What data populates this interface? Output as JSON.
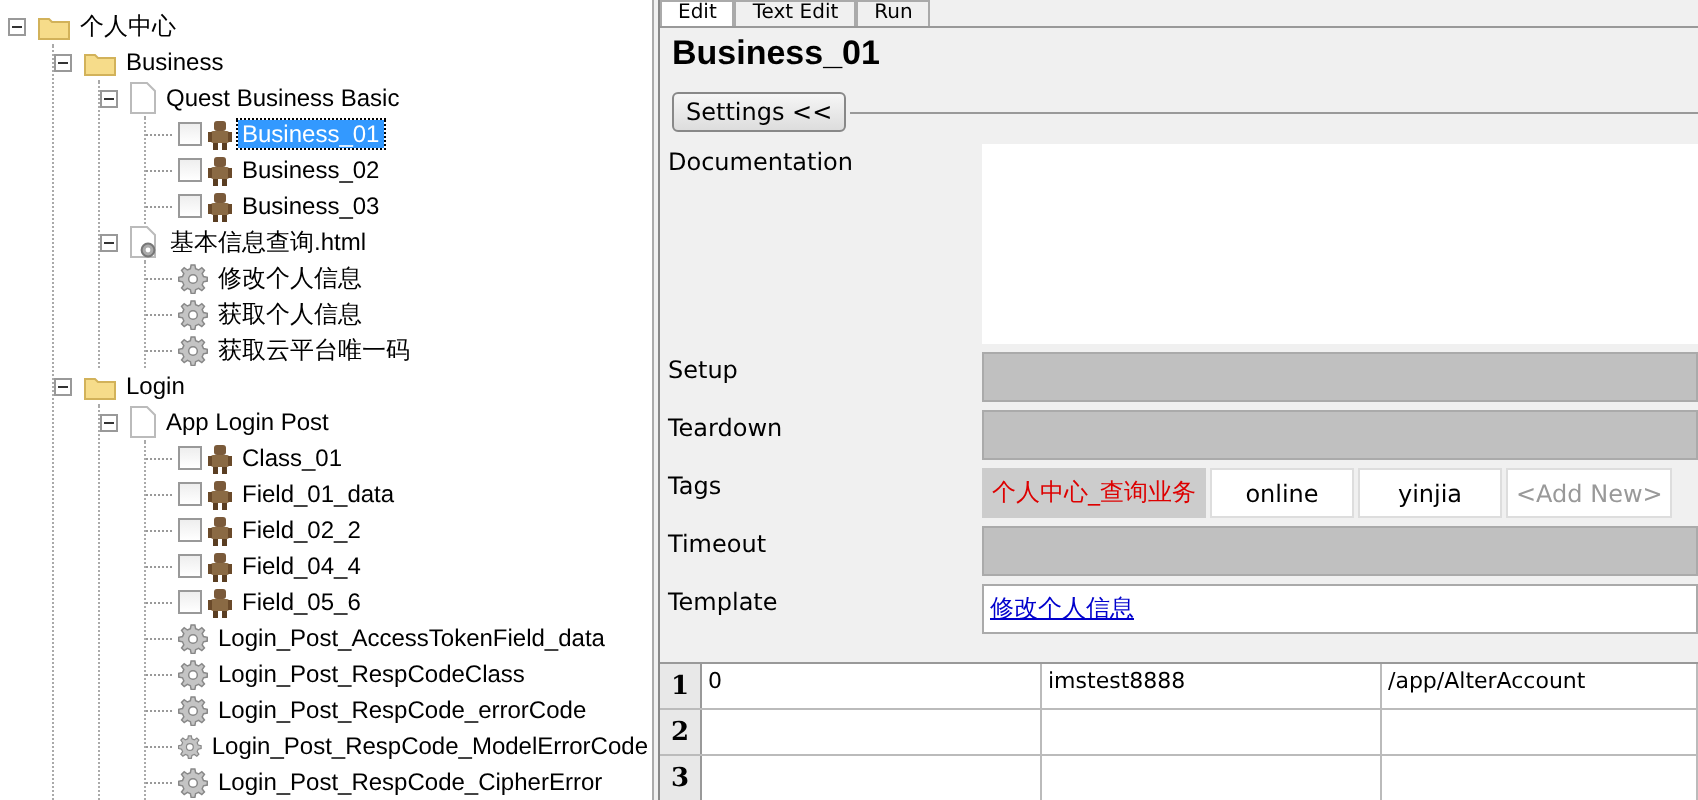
{
  "tree": [
    {
      "kind": "folder",
      "label": "个人中心",
      "expanded": true,
      "selected": false,
      "children": [
        {
          "kind": "folder",
          "label": "Business",
          "expanded": true,
          "selected": false,
          "children": [
            {
              "kind": "suite",
              "label": "Quest Business Basic",
              "expanded": true,
              "selected": false,
              "children": [
                {
                  "kind": "test",
                  "label": "Business_01",
                  "checked": false,
                  "selected": true
                },
                {
                  "kind": "test",
                  "label": "Business_02",
                  "checked": false,
                  "selected": false
                },
                {
                  "kind": "test",
                  "label": "Business_03",
                  "checked": false,
                  "selected": false
                }
              ]
            },
            {
              "kind": "resource",
              "label": "基本信息查询.html",
              "expanded": true,
              "selected": false,
              "children": [
                {
                  "kind": "keyword",
                  "label": "修改个人信息",
                  "selected": false
                },
                {
                  "kind": "keyword",
                  "label": "获取个人信息",
                  "selected": false
                },
                {
                  "kind": "keyword",
                  "label": "获取云平台唯一码",
                  "selected": false
                }
              ]
            }
          ]
        },
        {
          "kind": "folder",
          "label": "Login",
          "expanded": true,
          "selected": false,
          "children": [
            {
              "kind": "suite",
              "label": "App Login Post",
              "expanded": true,
              "selected": false,
              "children": [
                {
                  "kind": "test",
                  "label": "Class_01",
                  "checked": false,
                  "selected": false
                },
                {
                  "kind": "test",
                  "label": "Field_01_data",
                  "checked": false,
                  "selected": false
                },
                {
                  "kind": "test",
                  "label": "Field_02_2",
                  "checked": false,
                  "selected": false
                },
                {
                  "kind": "test",
                  "label": "Field_04_4",
                  "checked": false,
                  "selected": false
                },
                {
                  "kind": "test",
                  "label": "Field_05_6",
                  "checked": false,
                  "selected": false
                },
                {
                  "kind": "keyword",
                  "label": "Login_Post_AccessTokenField_data",
                  "selected": false
                },
                {
                  "kind": "keyword",
                  "label": "Login_Post_RespCodeClass",
                  "selected": false
                },
                {
                  "kind": "keyword",
                  "label": "Login_Post_RespCode_errorCode",
                  "selected": false
                },
                {
                  "kind": "keyword",
                  "label": "Login_Post_RespCode_ModelErrorCode",
                  "selected": false
                },
                {
                  "kind": "keyword",
                  "label": "Login_Post_RespCode_CipherError",
                  "selected": false
                }
              ]
            }
          ]
        }
      ]
    }
  ],
  "tabs": [
    {
      "label": "Edit",
      "selected": true
    },
    {
      "label": "Text Edit",
      "selected": false
    },
    {
      "label": "Run",
      "selected": false
    }
  ],
  "editor": {
    "title": "Business_01",
    "settings_button": "Settings <<",
    "fields": [
      {
        "kind": "text",
        "label": "Documentation"
      },
      {
        "kind": "empty",
        "label": "Setup"
      },
      {
        "kind": "empty",
        "label": "Teardown"
      },
      {
        "kind": "tags",
        "label": "Tags",
        "tags": [
          {
            "text": "个人中心_查询业务",
            "inherited": true
          },
          {
            "text": "online",
            "inherited": false
          },
          {
            "text": "yinjia",
            "inherited": false
          }
        ],
        "add_new": "<Add New>"
      },
      {
        "kind": "empty",
        "label": "Timeout"
      },
      {
        "kind": "link",
        "label": "Template",
        "value": "修改个人信息"
      }
    ]
  },
  "grid": {
    "rows": [
      {
        "header": "1",
        "cells": [
          "0",
          "imstest8888",
          "/app/AlterAccount"
        ]
      },
      {
        "header": "2",
        "cells": []
      },
      {
        "header": "3",
        "cells": []
      }
    ]
  }
}
